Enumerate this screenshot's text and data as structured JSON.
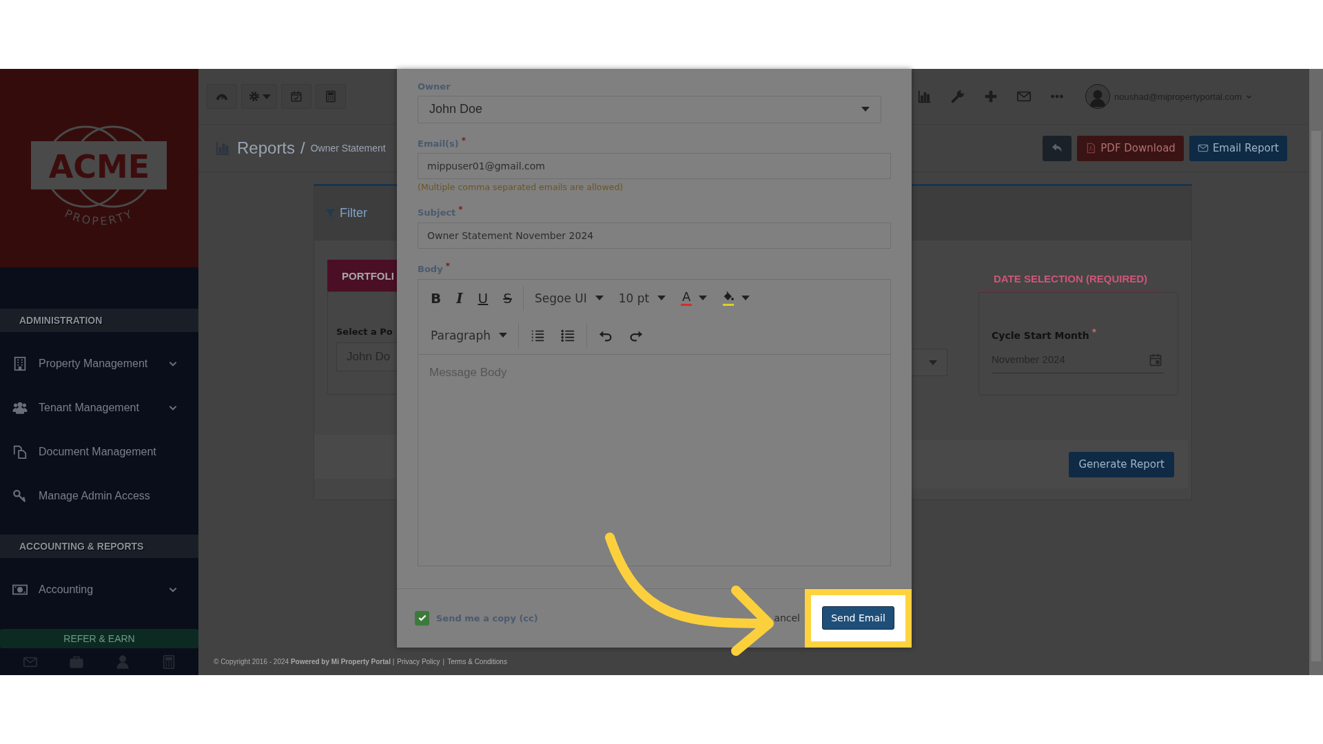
{
  "sidebar": {
    "logo": {
      "wordmark": "ACME",
      "tagline": "PROPERTY"
    },
    "sections": [
      {
        "title": "ADMINISTRATION",
        "items": [
          {
            "label": "Property Management",
            "kind": "building",
            "expandable": true
          },
          {
            "label": "Tenant Management",
            "kind": "people",
            "expandable": true
          },
          {
            "label": "Document Management",
            "kind": "documents",
            "expandable": false
          },
          {
            "label": "Manage Admin Access",
            "kind": "key",
            "expandable": false
          }
        ]
      },
      {
        "title": "ACCOUNTING & REPORTS",
        "items": [
          {
            "label": "Accounting",
            "kind": "banknote",
            "expandable": true
          }
        ]
      }
    ],
    "refer_button": "REFER & EARN",
    "bottom_icons": [
      {
        "kind": "mail"
      },
      {
        "kind": "briefcase"
      },
      {
        "kind": "user"
      },
      {
        "kind": "calculator"
      }
    ]
  },
  "toolbar": {
    "left_buttons": [
      {
        "kind": "gauge"
      },
      {
        "kind": "gear"
      },
      {
        "kind": "calendar-check"
      },
      {
        "kind": "calculator"
      }
    ],
    "right_icons": [
      {
        "kind": "bar-chart"
      },
      {
        "kind": "wrench"
      },
      {
        "kind": "plus"
      },
      {
        "kind": "mail"
      },
      {
        "kind": "more"
      }
    ],
    "user": {
      "email": "noushad@mipropertyportal.com"
    }
  },
  "breadcrumb": {
    "title": "Reports",
    "separator": "/",
    "current": "Owner Statement"
  },
  "actions": [
    {
      "kind": "back"
    },
    {
      "kind": "pdf",
      "label": "PDF Download"
    },
    {
      "kind": "email",
      "label": "Email Report"
    }
  ],
  "filter_card": {
    "title": "Filter",
    "portfolio_tab": "PORTFOLI",
    "portfolio_label": "Select a Po",
    "portfolio_value": "John Do",
    "date_tab": "DATE SELECTION (REQUIRED)",
    "cycle_label": "Cycle Start Month",
    "cycle_mark": "*",
    "cycle_value": "November 2024",
    "generate_button": "Generate Report"
  },
  "modal": {
    "owner": {
      "label": "Owner",
      "value": "John Doe"
    },
    "emails": {
      "label": "Email(s)",
      "required_mark": "*",
      "value": "mippuser01@gmail.com",
      "hint": "(Multiple comma separated emails are allowed)"
    },
    "subject": {
      "label": "Subject",
      "required_mark": "*",
      "value": "Owner Statement November 2024"
    },
    "body": {
      "label": "Body",
      "required_mark": "*",
      "placeholder": "Message Body",
      "toolbar": [
        [
          [
            {
              "kind": "bold",
              "label": "B"
            },
            {
              "kind": "italic",
              "label": "I"
            },
            {
              "kind": "underline",
              "label": "U"
            },
            {
              "kind": "strike",
              "label": "S"
            }
          ],
          [
            {
              "kind": "dropdown",
              "label": "Segoe UI"
            },
            {
              "kind": "dropdown",
              "label": "10 pt"
            },
            {
              "kind": "text-color",
              "label": "A",
              "color": "#d32f2f"
            },
            {
              "kind": "fill-color",
              "color": "#e0d020"
            }
          ]
        ],
        [
          [
            {
              "kind": "dropdown",
              "label": "Paragraph"
            }
          ],
          [
            {
              "kind": "ordered-list"
            },
            {
              "kind": "bullet-list"
            }
          ],
          [
            {
              "kind": "undo"
            },
            {
              "kind": "redo"
            }
          ]
        ]
      ]
    },
    "copy_checkbox": {
      "label": "Send me a copy (cc)",
      "checked": true
    },
    "cancel_button": "ancel",
    "send_button": "Send Email"
  },
  "footer": [
    {
      "kind": "text",
      "text": "© Copyright 2016 - 2024 **Powered by Mi Property Portal** |"
    },
    {
      "kind": "link",
      "text": "Privacy Policy"
    },
    {
      "kind": "text",
      "text": "|"
    },
    {
      "kind": "link",
      "text": "Terms & Conditions"
    }
  ]
}
